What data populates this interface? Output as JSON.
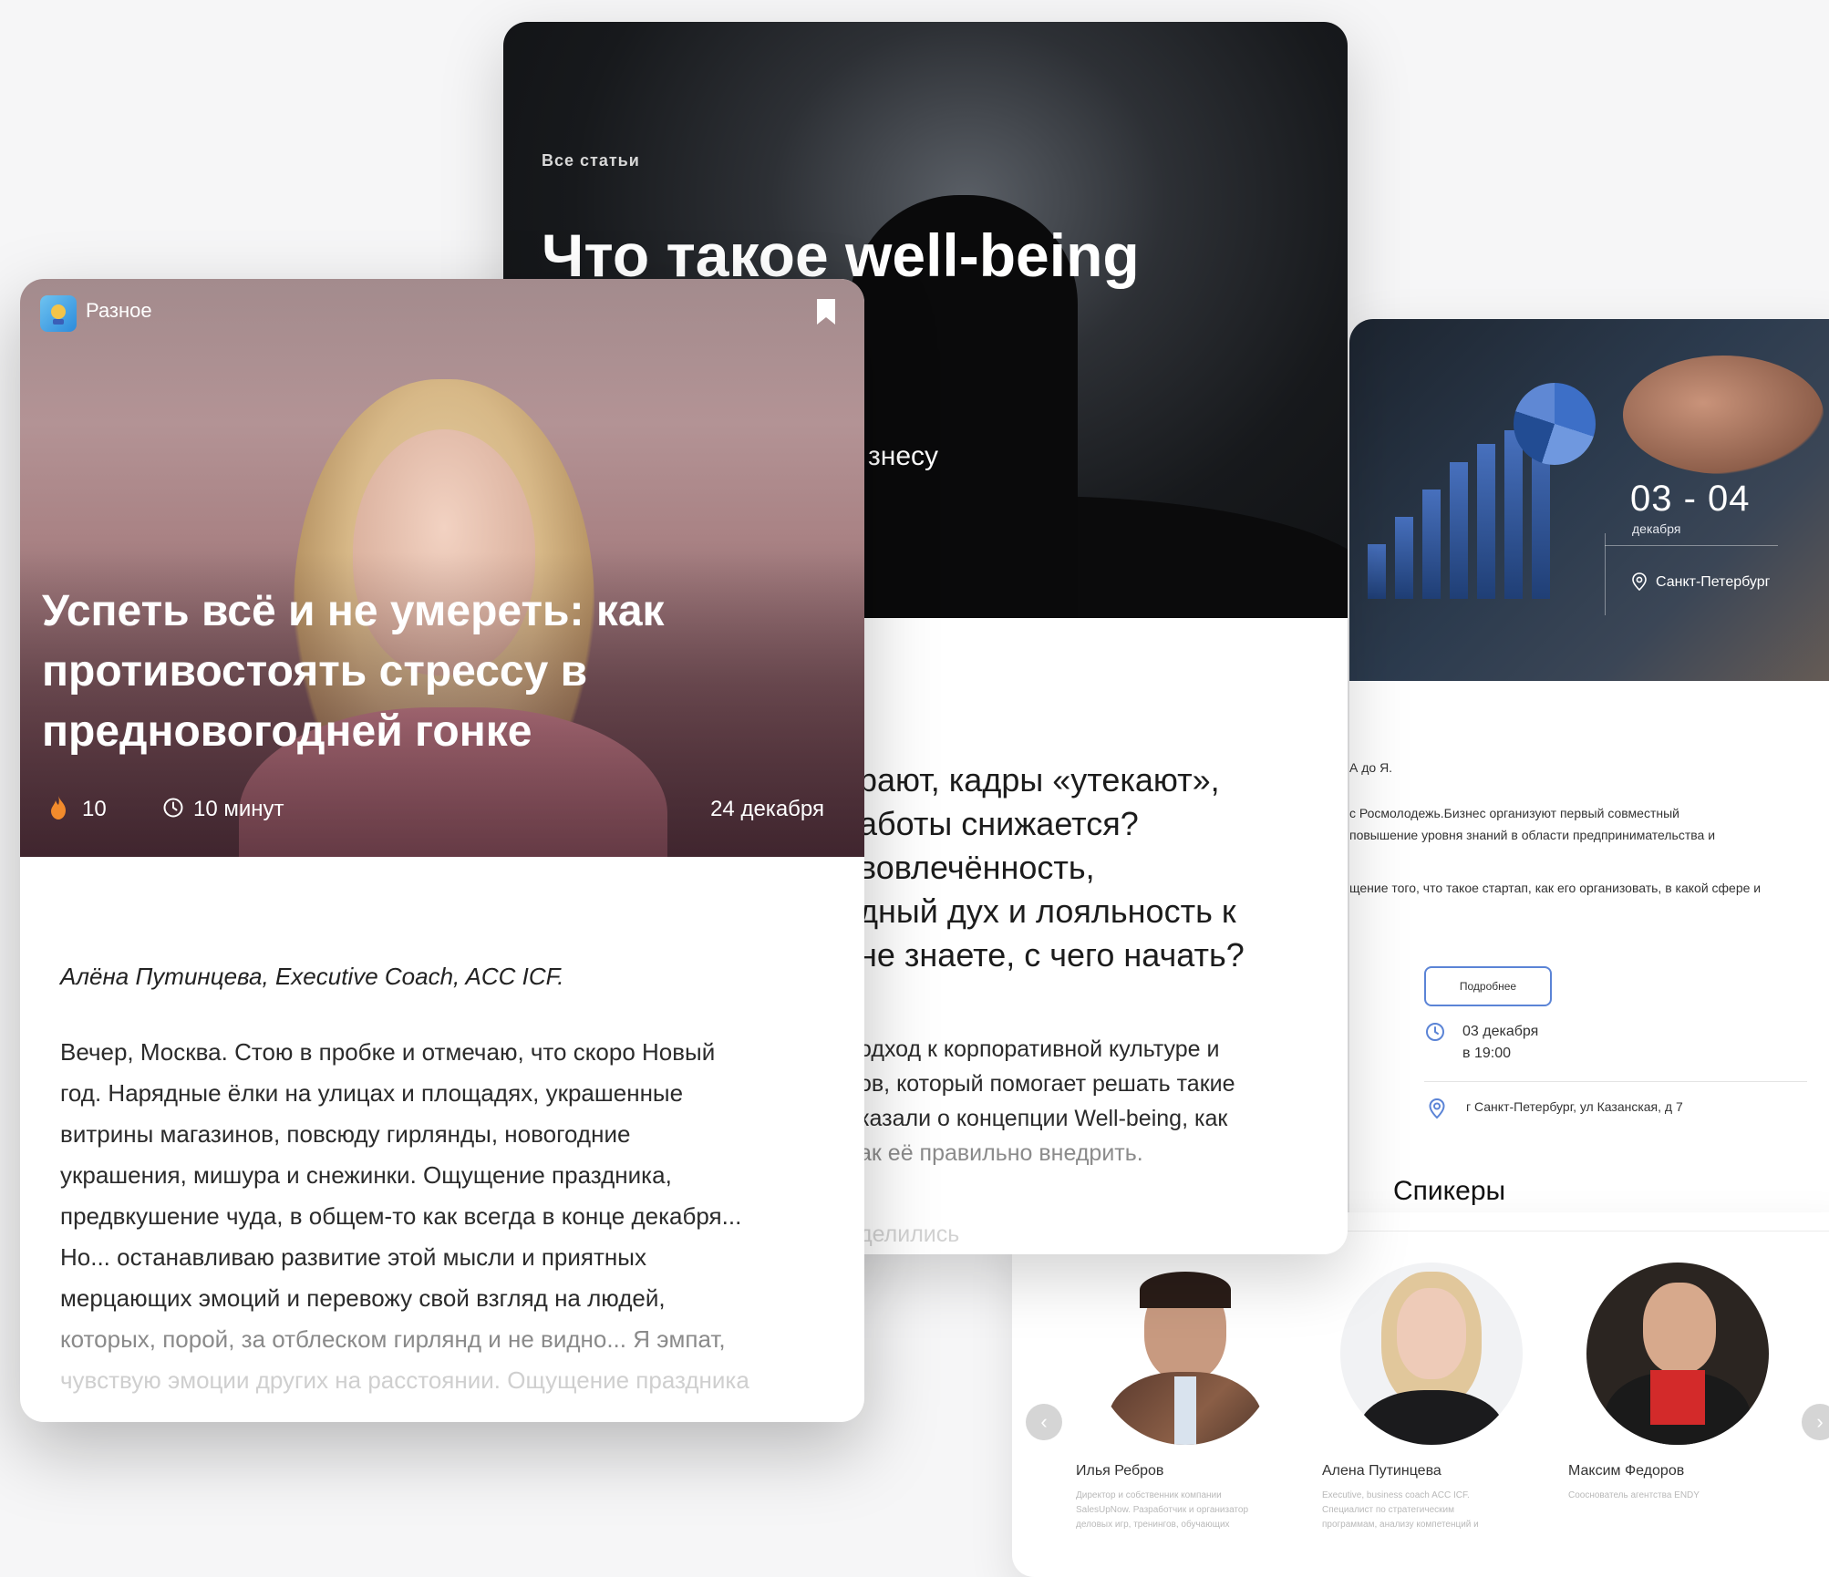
{
  "event": {
    "dates": "03 - 04",
    "month": "декабря",
    "city": "Санкт-Петербург",
    "text_lines": [
      "А до Я.",
      "с Росмолодежь.Бизнес организуют первый совместный",
      "повышение уровня знаний в области предпринимательства и",
      "щение того, что такое стартап, как его организовать, в какой сфере и"
    ],
    "details_button": "Подробнее",
    "date_line1": "03 декабря",
    "date_line2": "в 19:00",
    "address": "г Санкт-Петербург, ул Казанская, д 7",
    "speakers_title": "Спикеры",
    "speakers": [
      {
        "name": "Илья Ребров",
        "role": "Директор и собственник компании SalesUpNow. Разработчик и организатор деловых игр, тренингов, обучающих"
      },
      {
        "name": "Алена Путинцева",
        "role": "Executive, business coach ACC ICF. Специалист по стратегическим программам, анализу компетенций и"
      },
      {
        "name": "Максим Федоров",
        "role": "Сооснователь агентства ENDY"
      }
    ],
    "prev_arrow": "‹",
    "next_arrow": "›"
  },
  "article": {
    "breadcrumb": "Все статьи",
    "title": "Что такое well-being",
    "subtitle": "знесу",
    "lead_lines": [
      "рают, кадры «утекают»,",
      "аботы снижается?",
      " вовлечённость,",
      "дный дух и лояльность к",
      "не знаете, с чего начать?"
    ],
    "para_lines": [
      "одход к корпоративной культуре и",
      "ов, который помогает решать такие",
      "казали о концепции Well-being, как",
      "ак её правильно внедрить."
    ],
    "shared": "делились"
  },
  "featured": {
    "tag": "Разное",
    "title": "Успеть всё и не умереть: как противостоять стрессу в предновогодней гонке",
    "fire_count": "10",
    "read_time": "10 минут",
    "date": "24 декабря",
    "author": "Алёна Путинцева, Executive Coach, ACC ICF.",
    "text_lines": [
      "Вечер, Москва. Стою в пробке и отмечаю, что скоро Новый",
      "год. Нарядные ёлки на улицах и площадях, украшенные",
      "витрины магазинов, повсюду гирлянды, новогодние",
      "украшения, мишура и снежинки. Ощущение праздника,",
      "предвкушение чуда, в общем-то как всегда в конце декабря...",
      "Но... останавливаю развитие этой мысли и приятных",
      "мерцающих эмоций и перевожу свой взгляд на людей,",
      "которых, порой, за отблеском гирлянд и не видно... Я эмпат,",
      "чувствую эмоции других на расстоянии. Ощущение праздника"
    ],
    "colors": {
      "fire": "#f28b2c",
      "accent": "#5b84d6"
    }
  }
}
